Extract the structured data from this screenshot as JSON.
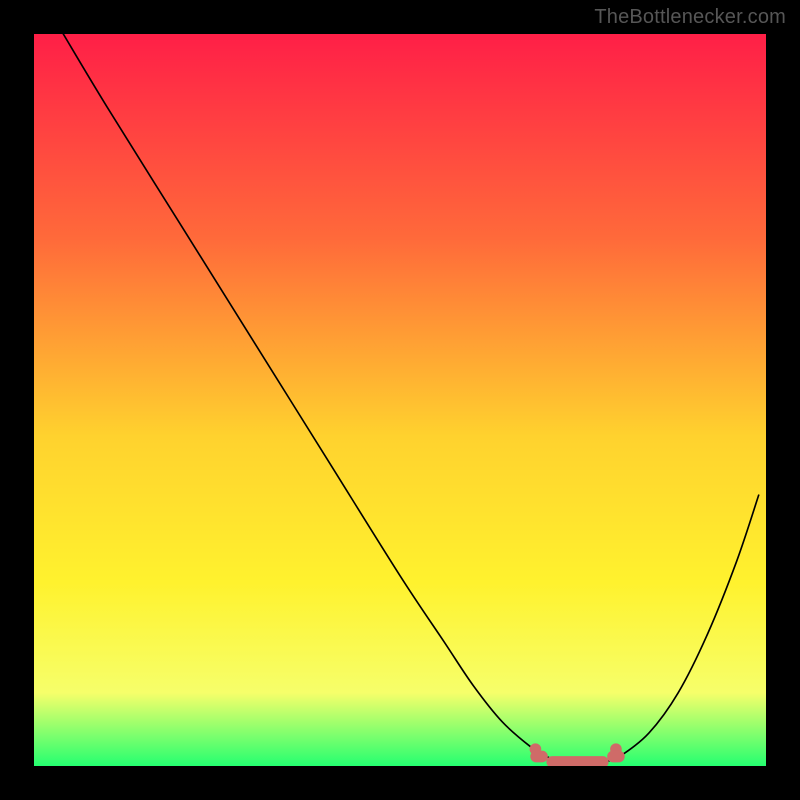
{
  "attribution": "TheBottlenecker.com",
  "colors": {
    "page_bg": "#000000",
    "gradient_top": "#ff1f47",
    "gradient_mid1": "#ff6a3a",
    "gradient_mid2": "#ffd22e",
    "gradient_mid3": "#fff22e",
    "gradient_mid4": "#f6ff6a",
    "gradient_bottom": "#25ff70",
    "curve": "#000000",
    "marker": "#cf6b68"
  },
  "chart_data": {
    "type": "line",
    "title": "",
    "xlabel": "",
    "ylabel": "",
    "xlim": [
      0,
      100
    ],
    "ylim": [
      0,
      100
    ],
    "grid": false,
    "legend": false,
    "series": [
      {
        "name": "bottleneck-curve",
        "x": [
          4,
          10,
          20,
          30,
          40,
          50,
          56,
          60,
          64,
          68,
          70,
          72,
          74,
          76,
          78,
          80,
          84,
          88,
          92,
          96,
          99
        ],
        "y": [
          100,
          90,
          74,
          58,
          42,
          26,
          17,
          11,
          6,
          2.5,
          1.3,
          0.6,
          0.25,
          0.25,
          0.6,
          1.3,
          4.5,
          10,
          18,
          28,
          37
        ],
        "stroke_width": 2
      }
    ],
    "markers": [
      {
        "name": "plateau-left-dot",
        "x": 68.5,
        "y": 2.3,
        "r": 3.2
      },
      {
        "name": "plateau-right-dot",
        "x": 79.5,
        "y": 2.3,
        "r": 3.2
      },
      {
        "name": "plateau-band-left",
        "shape": "rounded",
        "x0": 67.8,
        "x1": 70.2,
        "y": 1.3,
        "thickness": 1.6
      },
      {
        "name": "plateau-band-center",
        "shape": "rounded",
        "x0": 70.0,
        "x1": 78.5,
        "y": 0.55,
        "thickness": 1.6
      },
      {
        "name": "plateau-band-right",
        "shape": "rounded",
        "x0": 78.3,
        "x1": 80.7,
        "y": 1.3,
        "thickness": 1.6
      }
    ],
    "annotations": []
  }
}
